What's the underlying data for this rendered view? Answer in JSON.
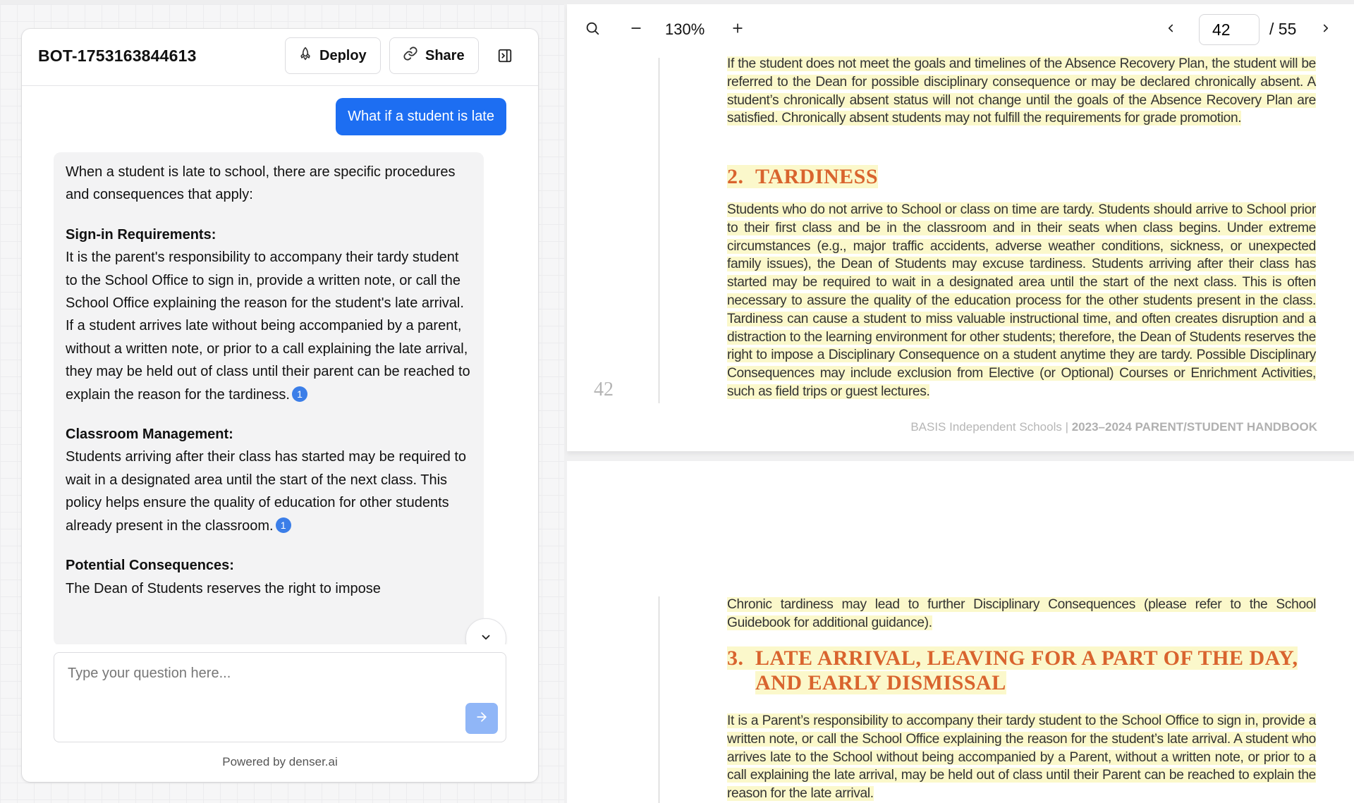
{
  "chat": {
    "bot_name": "BOT-1753163844613",
    "deploy_label": "Deploy",
    "share_label": "Share",
    "user_message": "What if a student is late",
    "answer": {
      "intro": "When a student is late to school, there are specific procedures and consequences that apply:",
      "section1_title": "Sign-in Requirements:",
      "section1_text": "It is the parent's responsibility to accompany their tardy student to the School Office to sign in, provide a written note, or call the School Office explaining the reason for the student's late arrival. If a student arrives late without being accompanied by a parent, without a written note, or prior to a call explaining the late arrival, they may be held out of class until their parent can be reached to explain the reason for the tardiness.",
      "section1_cite": "1",
      "section2_title": "Classroom Management:",
      "section2_text": "Students arriving after their class has started may be required to wait in a designated area until the start of the next class. This policy helps ensure the quality of education for other students already present in the classroom.",
      "section2_cite": "1",
      "section3_title": "Potential Consequences:",
      "section3_text": "The Dean of Students reserves the right to impose"
    },
    "input_placeholder": "Type your question here...",
    "powered_by": "Powered by denser.ai"
  },
  "viewer": {
    "zoom": "130%",
    "current_page": "42",
    "total_pages": "/ 55",
    "page1": {
      "intro_para": "If the student does not meet the goals and timelines of the Absence Recovery Plan, the student will be referred to the Dean for possible disciplinary consequence or may be declared chronically absent. A student’s chronically absent status will not change until the goals of the Absence Recovery Plan are satisfied. Chronically absent students may not fulfill the requirements for grade promotion.",
      "heading_num": "2.",
      "heading": "TARDINESS",
      "tardiness_para": "Students who do not arrive to School or class on time are tardy. Students should arrive to School prior to their first class and be in the classroom and in their seats when class begins. Under extreme circumstances (e.g., major traffic accidents, adverse weather conditions, sickness, or unexpected family issues), the Dean of Students may excuse tardiness. Students arriving after their class has started may be required to wait in a designated area until the start of the next class. This is often necessary to assure the quality of the education process for the other students present in the class. Tardiness can cause a student to miss valuable instructional time, and often creates disruption and a distraction to the learning environment for other students; therefore, the Dean of Students reserves the right to impose a Disciplinary Consequence on a student anytime they are tardy. Possible Disciplinary Consequences may include exclusion from Elective (or Optional) Courses or Enrichment Activities, such as field trips or guest lectures.",
      "page_number": "42",
      "footer_school": "BASIS Independent Schools | ",
      "footer_title": "2023–2024 PARENT/STUDENT HANDBOOK"
    },
    "page2": {
      "chronic_para": "Chronic tardiness may lead to further Disciplinary Consequences (please refer to the School Guidebook for additional guidance).",
      "heading_num": "3.",
      "heading_line1": "LATE ARRIVAL, LEAVING FOR A PART OF THE DAY,",
      "heading_line2": "AND EARLY DISMISSAL",
      "late_para": "It is a Parent’s responsibility to accompany their tardy student to the School Office to sign in, provide a written note, or call the School Office explaining the reason for the student’s late arrival. A student who arrives late to the School without being accompanied by a Parent, without a written note, or prior to a call explaining the late arrival, may be held out of class until their Parent can be reached to explain the reason for the late arrival."
    }
  }
}
